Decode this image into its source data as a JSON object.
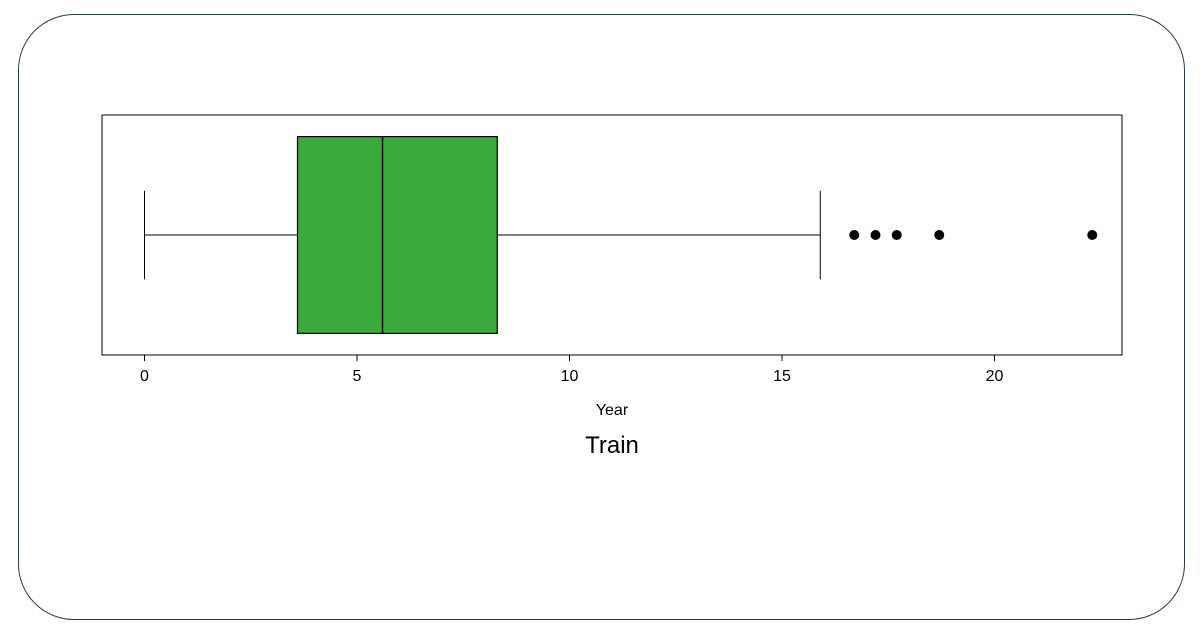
{
  "chart_data": {
    "type": "boxplot",
    "title": "Train",
    "xlabel": "Year",
    "x_ticks": [
      0,
      5,
      10,
      15,
      20
    ],
    "x_range": [
      -1,
      23
    ],
    "box": {
      "min_whisker": 0.0,
      "q1": 3.6,
      "median": 5.6,
      "q3": 8.3,
      "max_whisker": 15.9
    },
    "outliers": [
      16.7,
      17.2,
      17.7,
      18.7,
      22.3
    ],
    "box_color": "#3ca93c",
    "line_color": "#000000"
  },
  "labels": {
    "xlabel": "Year",
    "title": "Train"
  }
}
